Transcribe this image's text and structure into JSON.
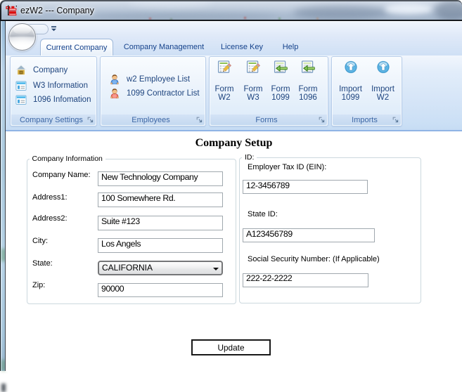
{
  "colors": {
    "ribbon_text": "#1e447e",
    "tab_text": "#15428b",
    "ribbon_border_bottom": "#8fb4e5",
    "group_caption_text": "#3c66a4",
    "title_glass": "#aebfd3"
  },
  "window": {
    "title": "ezW2 --- Company",
    "app_icon": "ezw2-app-icon"
  },
  "quick_access": {
    "orb_icon": "application-orb",
    "dropdown_icon": "qat-dropdown-icon"
  },
  "ribbon": {
    "tabs": [
      {
        "label": "Current Company",
        "active": true
      },
      {
        "label": "Company Management",
        "active": false
      },
      {
        "label": "License Key",
        "active": false
      },
      {
        "label": "Help",
        "active": false
      }
    ],
    "groups": [
      {
        "label": "Company Settings",
        "dialog_launcher": "dialog-launcher-icon",
        "items": [
          {
            "icon": "home-icon",
            "label": "Company"
          },
          {
            "icon": "form-window-icon",
            "label": "W3 Information"
          },
          {
            "icon": "form-window-icon",
            "label": "1096 Infomation"
          }
        ]
      },
      {
        "label": "Employees",
        "dialog_launcher": "dialog-launcher-icon",
        "items": [
          {
            "icon": "person-blue-icon",
            "label": "w2 Employee List"
          },
          {
            "icon": "person-red-icon",
            "label": "1099 Contractor List"
          }
        ]
      },
      {
        "label": "Forms",
        "dialog_launcher": "dialog-launcher-icon",
        "items": [
          {
            "icon": "form-edit-icon",
            "line1": "Form",
            "line2": "W2"
          },
          {
            "icon": "form-edit-icon",
            "line1": "Form",
            "line2": "W3"
          },
          {
            "icon": "form-import-icon",
            "line1": "Form",
            "line2": "1099"
          },
          {
            "icon": "form-import-icon",
            "line1": "Form",
            "line2": "1096"
          }
        ]
      },
      {
        "label": "Imports",
        "dialog_launcher": "dialog-launcher-icon",
        "items": [
          {
            "icon": "import-icon",
            "line1": "Import",
            "line2": "1099"
          },
          {
            "icon": "import-icon",
            "line1": "Import",
            "line2": "W2"
          }
        ]
      }
    ]
  },
  "content": {
    "page_title": "Company Setup",
    "company_info": {
      "legend": "Company Information",
      "fields": [
        {
          "label": "Company Name:",
          "value": "New Technology Company"
        },
        {
          "label": "Address1:",
          "value": "100 Somewhere Rd."
        },
        {
          "label": "Address2:",
          "value": "Suite #123"
        },
        {
          "label": "City:",
          "value": "Los Angels"
        },
        {
          "label": "State:",
          "value": "CALIFORNIA"
        },
        {
          "label": "Zip:",
          "value": "90000"
        }
      ]
    },
    "ids": {
      "legend": "ID:",
      "fields": [
        {
          "label": "Employer Tax ID (EIN):",
          "value": "12-3456789"
        },
        {
          "label": "State ID:",
          "value": "A123456789"
        },
        {
          "label": "Social Security Number: (If Applicable)",
          "value": "222-22-2222"
        }
      ]
    },
    "update_label": "Update"
  }
}
